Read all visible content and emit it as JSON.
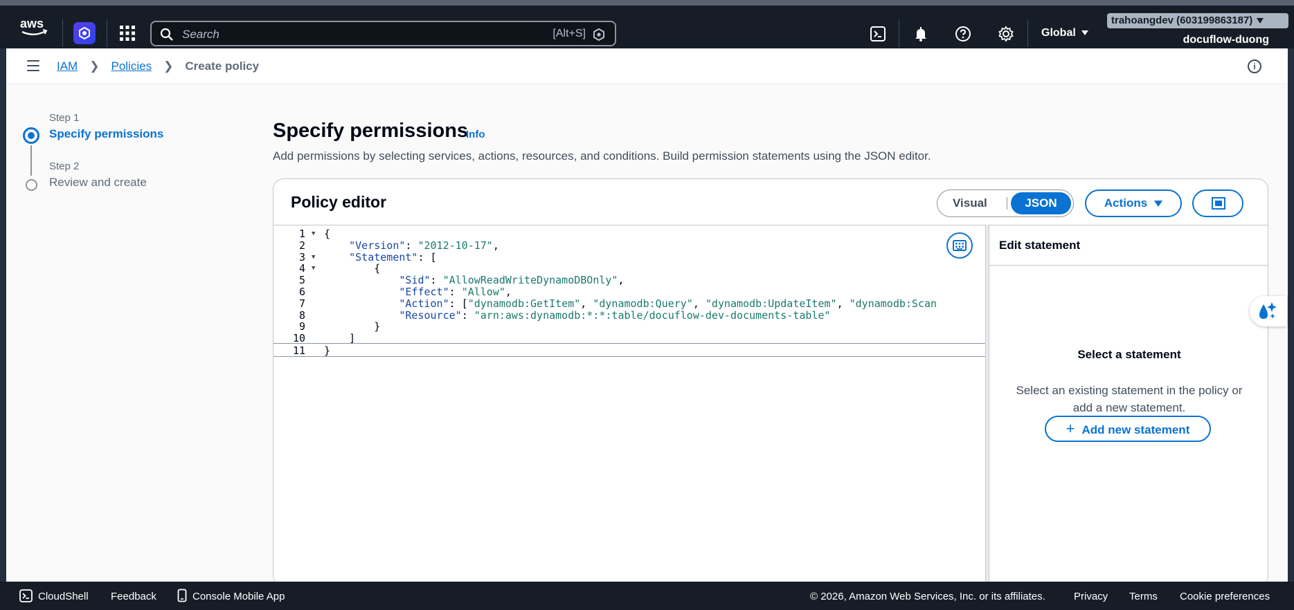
{
  "topnav": {
    "logo": "aws",
    "search_placeholder": "Search",
    "search_shortcut": "[Alt+S]",
    "region": "Global",
    "account": "trahoangdev (603199863187)",
    "account_sub": "docuflow-duong",
    "icons": [
      "cloudshell-icon",
      "bell-icon",
      "help-icon",
      "gear-icon"
    ]
  },
  "breadcrumb": {
    "items": [
      "IAM",
      "Policies"
    ],
    "current": "Create policy"
  },
  "wizard": {
    "step1_label": "Step 1",
    "step1_title": "Specify permissions",
    "step2_label": "Step 2",
    "step2_title": "Review and create"
  },
  "page": {
    "title": "Specify permissions",
    "info": "Info",
    "description": "Add permissions by selecting services, actions, resources, and conditions. Build permission statements using the JSON editor."
  },
  "editor": {
    "title": "Policy editor",
    "mode_visual": "Visual",
    "mode_json": "JSON",
    "actions_label": "Actions",
    "lines": [
      {
        "n": "1",
        "fold": true,
        "indent": "",
        "parts": [
          [
            "p",
            "{"
          ]
        ]
      },
      {
        "n": "2",
        "fold": false,
        "indent": "    ",
        "parts": [
          [
            "k",
            "\"Version\""
          ],
          [
            "p",
            ": "
          ],
          [
            "s",
            "\"2012-10-17\""
          ],
          [
            "p",
            ","
          ]
        ]
      },
      {
        "n": "3",
        "fold": true,
        "indent": "    ",
        "parts": [
          [
            "k",
            "\"Statement\""
          ],
          [
            "p",
            ": ["
          ]
        ]
      },
      {
        "n": "4",
        "fold": true,
        "indent": "        ",
        "parts": [
          [
            "p",
            "{"
          ]
        ]
      },
      {
        "n": "5",
        "fold": false,
        "indent": "            ",
        "parts": [
          [
            "k",
            "\"Sid\""
          ],
          [
            "p",
            ": "
          ],
          [
            "s",
            "\"AllowReadWriteDynamoDBOnly\""
          ],
          [
            "p",
            ","
          ]
        ]
      },
      {
        "n": "6",
        "fold": false,
        "indent": "            ",
        "parts": [
          [
            "k",
            "\"Effect\""
          ],
          [
            "p",
            ": "
          ],
          [
            "s",
            "\"Allow\""
          ],
          [
            "p",
            ","
          ]
        ]
      },
      {
        "n": "7",
        "fold": false,
        "indent": "            ",
        "parts": [
          [
            "k",
            "\"Action\""
          ],
          [
            "p",
            ": ["
          ],
          [
            "s",
            "\"dynamodb:GetItem\""
          ],
          [
            "p",
            ", "
          ],
          [
            "s",
            "\"dynamodb:Query\""
          ],
          [
            "p",
            ", "
          ],
          [
            "s",
            "\"dynamodb:UpdateItem\""
          ],
          [
            "p",
            ", "
          ],
          [
            "s",
            "\"dynamodb:Scan"
          ]
        ]
      },
      {
        "n": "8",
        "fold": false,
        "indent": "            ",
        "parts": [
          [
            "k",
            "\"Resource\""
          ],
          [
            "p",
            ": "
          ],
          [
            "s",
            "\"arn:aws:dynamodb:*:*:table/docuflow-dev-documents-table\""
          ]
        ]
      },
      {
        "n": "9",
        "fold": false,
        "indent": "        ",
        "parts": [
          [
            "p",
            "}"
          ]
        ]
      },
      {
        "n": "10",
        "fold": false,
        "indent": "    ",
        "parts": [
          [
            "p",
            "]"
          ]
        ]
      },
      {
        "n": "11",
        "fold": false,
        "indent": "",
        "parts": [
          [
            "p",
            "}"
          ]
        ]
      }
    ]
  },
  "side_panel": {
    "title": "Edit statement",
    "heading": "Select a statement",
    "text": "Select an existing statement in the policy or add a new statement.",
    "add_button": "Add new statement"
  },
  "footer": {
    "cloudshell": "CloudShell",
    "feedback": "Feedback",
    "mobile": "Console Mobile App",
    "copyright": "© 2026, Amazon Web Services, Inc. or its affiliates.",
    "privacy": "Privacy",
    "terms": "Terms",
    "cookies": "Cookie preferences"
  },
  "colors": {
    "accent": "#0972d3",
    "nav_bg": "#161d26",
    "json_key": "#1848a2",
    "json_string": "#1a7a6b"
  }
}
